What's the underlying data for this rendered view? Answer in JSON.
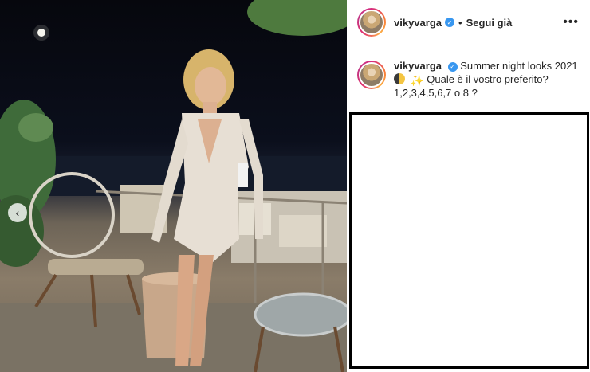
{
  "post": {
    "username": "vikyvarga",
    "follow_label": "Segui già",
    "separator": "•",
    "more_icon": "more-options-icon",
    "verified_icon": "verified-badge-icon",
    "caption": {
      "username": "vikyvarga",
      "line1": "Summer night looks 2021",
      "line2": "Quale è il vostro preferito?",
      "line3": "1,2,3,4,5,6,7 o 8 ?"
    },
    "carousel_prev_icon": "chevron-left-icon"
  },
  "colors": {
    "verified": "#3897f0",
    "text": "#262626",
    "divider": "#dbdbdb"
  }
}
